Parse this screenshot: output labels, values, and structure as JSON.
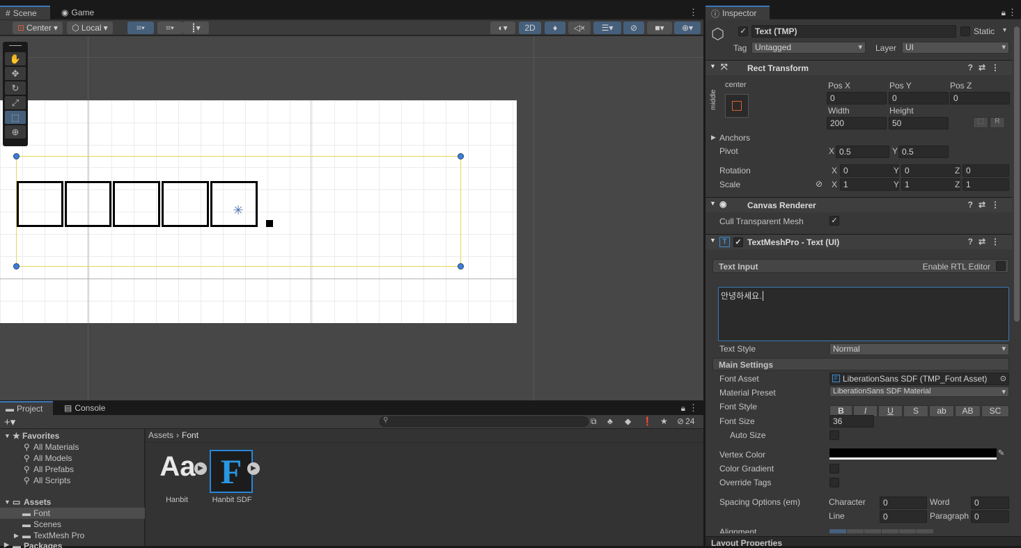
{
  "scene": {
    "tabs": [
      "Scene",
      "Game"
    ],
    "toolbar": {
      "pivot": "Center",
      "space": "Local",
      "mode_2d": "2D"
    },
    "text_preview_chars": [
      "□",
      "□",
      "□",
      "□",
      "□",
      "."
    ]
  },
  "project": {
    "tabs": [
      "Project",
      "Console"
    ],
    "search_placeholder": "",
    "hidden_count": "24",
    "favorites_label": "Favorites",
    "favorites": [
      "All Materials",
      "All Models",
      "All Prefabs",
      "All Scripts"
    ],
    "assets_label": "Assets",
    "assets_children": [
      "Font",
      "Scenes",
      "TextMesh Pro"
    ],
    "packages_label": "Packages",
    "breadcrumb": [
      "Assets",
      "Font"
    ],
    "items": [
      {
        "name": "Hanbit",
        "glyph": "Aa"
      },
      {
        "name": "Hanbit SDF",
        "glyph": "F"
      }
    ]
  },
  "inspector": {
    "tab": "Inspector",
    "object_name": "Text (TMP)",
    "static_label": "Static",
    "tag_label": "Tag",
    "tag_value": "Untagged",
    "layer_label": "Layer",
    "layer_value": "UI",
    "rect_transform": {
      "title": "Rect Transform",
      "anchor_h": "center",
      "anchor_v": "middle",
      "pos_x_label": "Pos X",
      "pos_x": "0",
      "pos_y_label": "Pos Y",
      "pos_y": "0",
      "pos_z_label": "Pos Z",
      "pos_z": "0",
      "width_label": "Width",
      "width": "200",
      "height_label": "Height",
      "height": "50",
      "r_button": "R",
      "anchors_label": "Anchors",
      "pivot_label": "Pivot",
      "pivot_x": "0.5",
      "pivot_y": "0.5",
      "rotation_label": "Rotation",
      "rot_x": "0",
      "rot_y": "0",
      "rot_z": "0",
      "scale_label": "Scale",
      "scale_x": "1",
      "scale_y": "1",
      "scale_z": "1",
      "x": "X",
      "y": "Y",
      "z": "Z"
    },
    "canvas_renderer": {
      "title": "Canvas Renderer",
      "cull_label": "Cull Transparent Mesh",
      "cull_checked": true
    },
    "tmp": {
      "title": "TextMeshPro - Text (UI)",
      "text_input_label": "Text Input",
      "rtl_label": "Enable RTL Editor",
      "text_value": "안녕하세요.",
      "text_style_label": "Text Style",
      "text_style_value": "Normal",
      "main_settings_label": "Main Settings",
      "font_asset_label": "Font Asset",
      "font_asset_value": "LiberationSans SDF (TMP_Font Asset)",
      "material_preset_label": "Material Preset",
      "material_preset_value": "LiberationSans SDF Material",
      "font_style_label": "Font Style",
      "font_style_buttons": [
        "B",
        "I",
        "U",
        "S",
        "ab",
        "AB",
        "SC"
      ],
      "font_size_label": "Font Size",
      "font_size_value": "36",
      "auto_size_label": "Auto Size",
      "vertex_color_label": "Vertex Color",
      "vertex_color": "#000000",
      "color_gradient_label": "Color Gradient",
      "override_tags_label": "Override Tags",
      "spacing_label": "Spacing Options (em)",
      "character_label": "Character",
      "character_value": "0",
      "word_label": "Word",
      "word_value": "0",
      "line_label": "Line",
      "line_value": "0",
      "paragraph_label": "Paragraph",
      "paragraph_value": "0",
      "alignment_label": "Alignment",
      "layout_properties_label": "Layout Properties"
    }
  },
  "colors": {
    "accent": "#3a79bb",
    "selection_yellow": "#e5d852",
    "handle_blue": "#3f7fd9"
  }
}
